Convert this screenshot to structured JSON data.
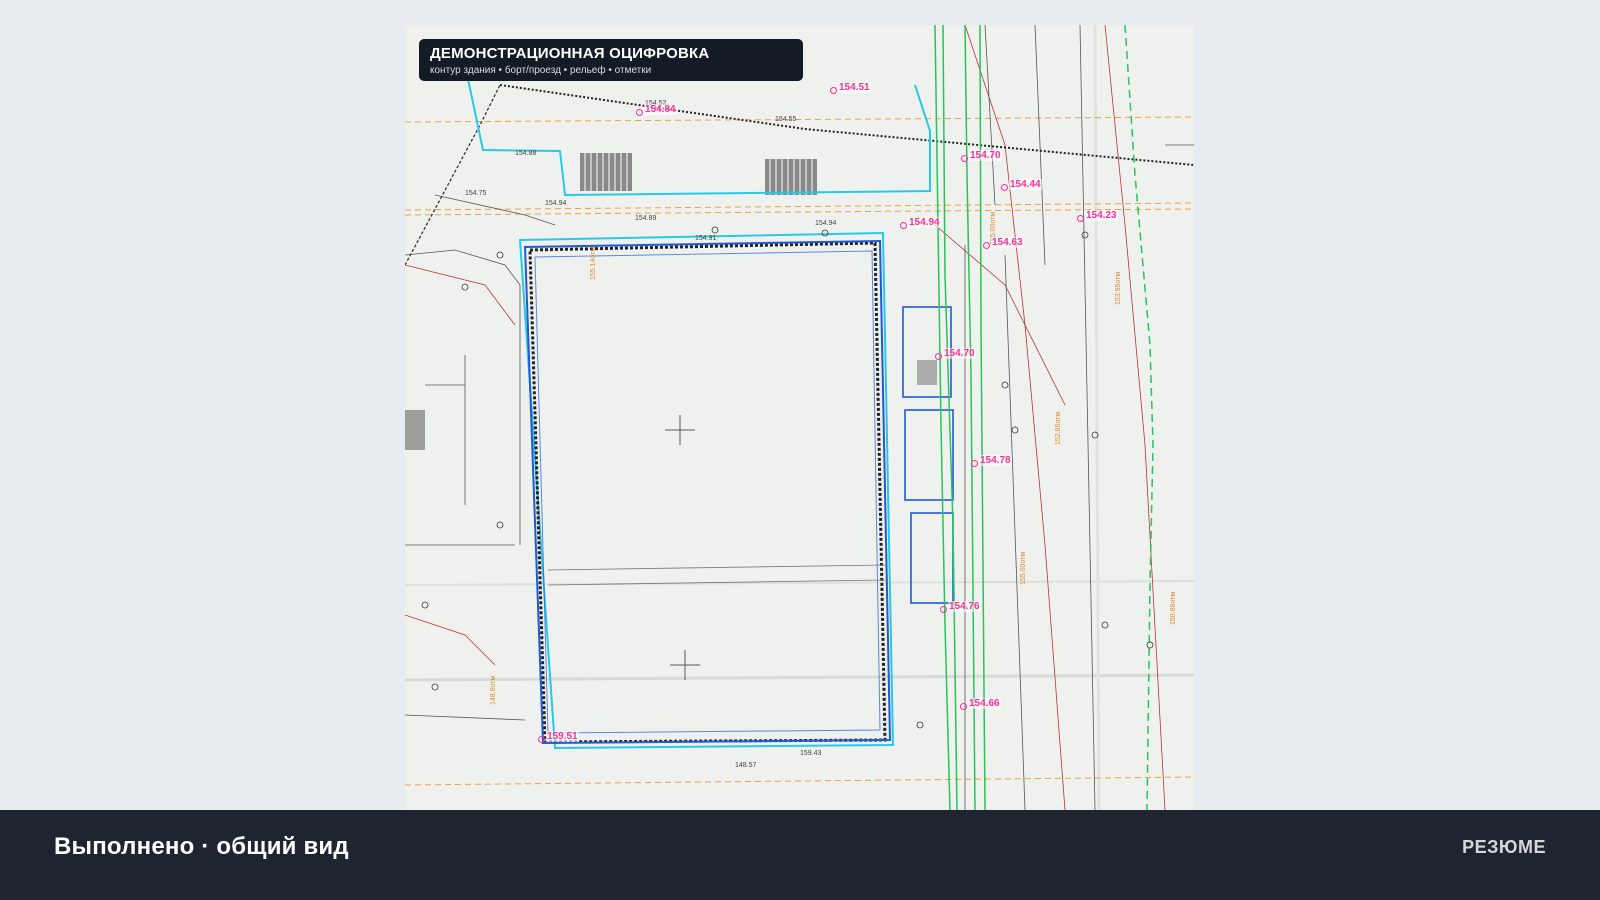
{
  "overlay": {
    "title": "ДЕМОНСТРАЦИОННАЯ ОЦИФРОВКА",
    "subtitle": "контур здания • борт/проезд • рельеф • отметки"
  },
  "elevations": [
    {
      "label": "154.51"
    },
    {
      "label": "154.84"
    },
    {
      "label": "154.70"
    },
    {
      "label": "154.44"
    },
    {
      "label": "154.94"
    },
    {
      "label": "154.23"
    },
    {
      "label": "154.63"
    },
    {
      "label": "154.70"
    },
    {
      "label": "154.78"
    },
    {
      "label": "154.76"
    },
    {
      "label": "154.66"
    },
    {
      "label": "159.51"
    }
  ],
  "bottom_bar": {
    "status": "Выполнено · общий вид",
    "summary_label": "РЕЗЮМЕ"
  },
  "colors": {
    "building_outline": "#1f5ad6",
    "curb_outline": "#27c9e6",
    "contour_line": "#27c45a",
    "elevation_mark": "#ff2f9a",
    "drawing_orange": "#f0a040",
    "bar_background": "#1f2530"
  }
}
